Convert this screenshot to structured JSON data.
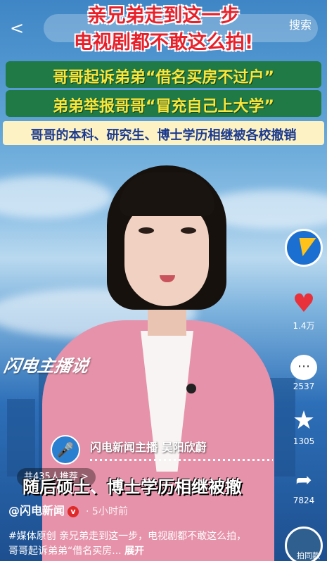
{
  "header": {
    "back_glyph": "<",
    "search_label": "搜索"
  },
  "headlines": {
    "line1": "亲兄弟走到这一步",
    "line2": "电视剧都不敢这么拍!",
    "line3": "哥哥起诉弟弟“借名买房不过户”",
    "line4": "弟弟举报哥哥“冒充自己上大学”",
    "line5": "哥哥的本科、研究生、博士学历相继被各校撤销"
  },
  "rail": {
    "like_count": "1.4万",
    "comment_count": "2537",
    "favorite_count": "1305",
    "share_count": "7824",
    "music_label": "拍同款"
  },
  "video": {
    "brand_tag": "闪电主播说",
    "anchor_name": "闪电新闻主播 吴阳欣蔚",
    "subtitle": "随后硕士、博士学历相继被撤",
    "recommend": "共435人推荐 >"
  },
  "post": {
    "author": "@闪电新闻",
    "verified_glyph": "v",
    "time": "· 5小时前",
    "description": "#媒体原创 亲兄弟走到这一步，电视剧都不敢这么拍，哥哥起诉弟弟“借名买房...",
    "expand_label": "展开"
  },
  "colors": {
    "headline_red": "#e8202a",
    "banner_green": "#1f7a45",
    "banner_yellow_text": "#fbe63a",
    "info_box_bg": "#fdf2c4",
    "info_box_text": "#1b3a8f",
    "heart": "#e8313a",
    "jacket_pink": "#e592aa"
  },
  "icons": {
    "back": "chevron-left-icon",
    "logo": "lightning-logo-icon",
    "like": "heart-icon",
    "comment": "comment-bubble-icon",
    "favorite": "star-icon",
    "share": "share-arrow-icon",
    "anchor": "microphone-icon",
    "music": "music-disc-icon"
  }
}
